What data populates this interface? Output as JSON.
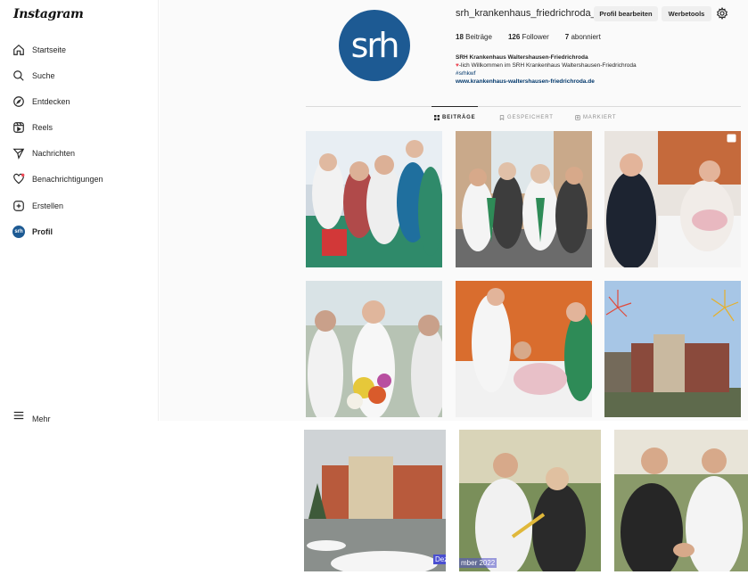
{
  "sidebar": {
    "logo": "Instagram",
    "items": [
      {
        "label": "Startseite",
        "icon": "home-icon"
      },
      {
        "label": "Suche",
        "icon": "search-icon"
      },
      {
        "label": "Entdecken",
        "icon": "compass-icon"
      },
      {
        "label": "Reels",
        "icon": "reels-icon"
      },
      {
        "label": "Nachrichten",
        "icon": "send-icon"
      },
      {
        "label": "Benachrichtigungen",
        "icon": "heart-icon"
      },
      {
        "label": "Erstellen",
        "icon": "plus-square-icon"
      },
      {
        "label": "Profil",
        "icon": "avatar"
      }
    ],
    "more": "Mehr"
  },
  "profile": {
    "avatar_text": "srh",
    "username": "srh_krankenhaus_friedrichroda_",
    "edit_button": "Profil bearbeiten",
    "tools_button": "Werbetools",
    "stats": {
      "posts_count": "18",
      "posts_label": "Beiträge",
      "followers_count": "126",
      "followers_label": "Follower",
      "following_count": "7",
      "following_label": "abonniert"
    },
    "bio": {
      "name": "SRH Krankenhaus Waltershausen-Friedrichroda",
      "line1": "-lich Willkommen im SRH Krankenhaus Waltershausen-Friedrichroda",
      "hashtag": "#srhkwf",
      "link": "www.krankenhaus-waltershausen-friedrichroda.de"
    }
  },
  "tabs": [
    {
      "label": "BEITRÄGE",
      "icon": "grid-icon",
      "active": true
    },
    {
      "label": "GESPEICHERT",
      "icon": "bookmark-icon",
      "active": false
    },
    {
      "label": "MARKIERT",
      "icon": "tagged-icon",
      "active": false
    }
  ],
  "overlay": {
    "label_left": "Dez",
    "label_right": "mber 2022"
  },
  "colors": {
    "brand": "#1d5a93",
    "link": "#00376b",
    "accent_green": "#2e8b57"
  }
}
